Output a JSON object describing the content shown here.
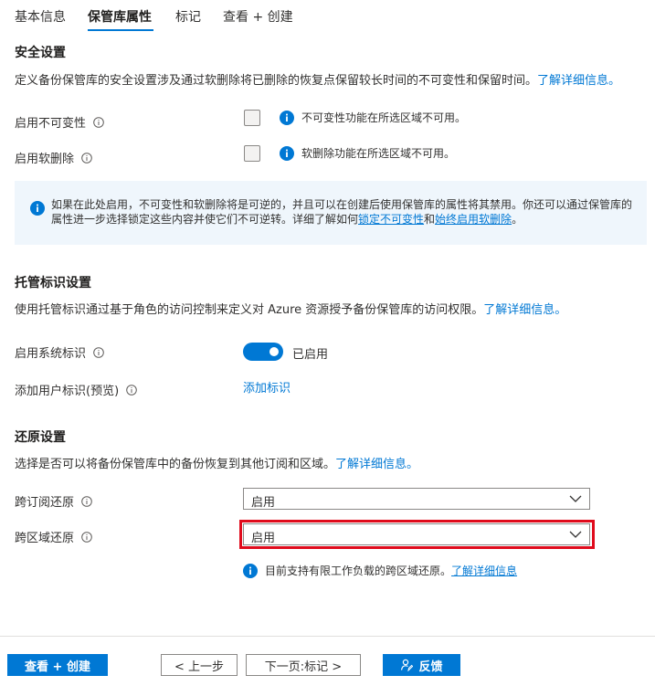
{
  "tabs": [
    {
      "label": "基本信息"
    },
    {
      "label": "保管库属性"
    },
    {
      "label": "标记"
    },
    {
      "label": "查看 + 创建"
    }
  ],
  "security": {
    "title": "安全设置",
    "desc": "定义备份保管库的安全设置涉及通过软删除将已删除的恢复点保留较长时间的不可变性和保留时间。",
    "learn_more": "了解详细信息。",
    "immutability_label": "启用不可变性",
    "immutability_note": "不可变性功能在所选区域不可用。",
    "softdelete_label": "启用软删除",
    "softdelete_note": "软删除功能在所选区域不可用。",
    "info_text_1": "如果在此处启用，不可变性和软删除将是可逆的，并且可以在创建后使用保管库的属性将其禁用。你还可以通过保管库的属性进一步选择锁定这些内容并使它们不可逆转。详细了解如何",
    "info_link_1": "锁定不可变性",
    "info_text_2": "和",
    "info_link_2": "始终启用软删除",
    "info_text_3": "。"
  },
  "identity": {
    "title": "托管标识设置",
    "desc": "使用托管标识通过基于角色的访问控制来定义对 Azure 资源授予备份保管库的访问权限。",
    "learn_more": "了解详细信息。",
    "system_label": "启用系统标识",
    "system_state": "已启用",
    "user_label": "添加用户标识(预览)",
    "user_link": "添加标识"
  },
  "restore": {
    "title": "还原设置",
    "desc": "选择是否可以将备份保管库中的备份恢复到其他订阅和区域。",
    "learn_more": "了解详细信息。",
    "cross_sub_label": "跨订阅还原",
    "cross_sub_value": "启用",
    "cross_region_label": "跨区域还原",
    "cross_region_value": "启用",
    "note": "目前支持有限工作负载的跨区域还原。",
    "note_link": "了解详细信息"
  },
  "footer": {
    "review_create": "查看 + 创建",
    "previous": "< 上一步",
    "next": "下一页:标记 >",
    "feedback": "反馈"
  },
  "colors": {
    "accent": "#0078d4",
    "highlight": "#e00b1c",
    "info_bg": "#eff6fc"
  }
}
